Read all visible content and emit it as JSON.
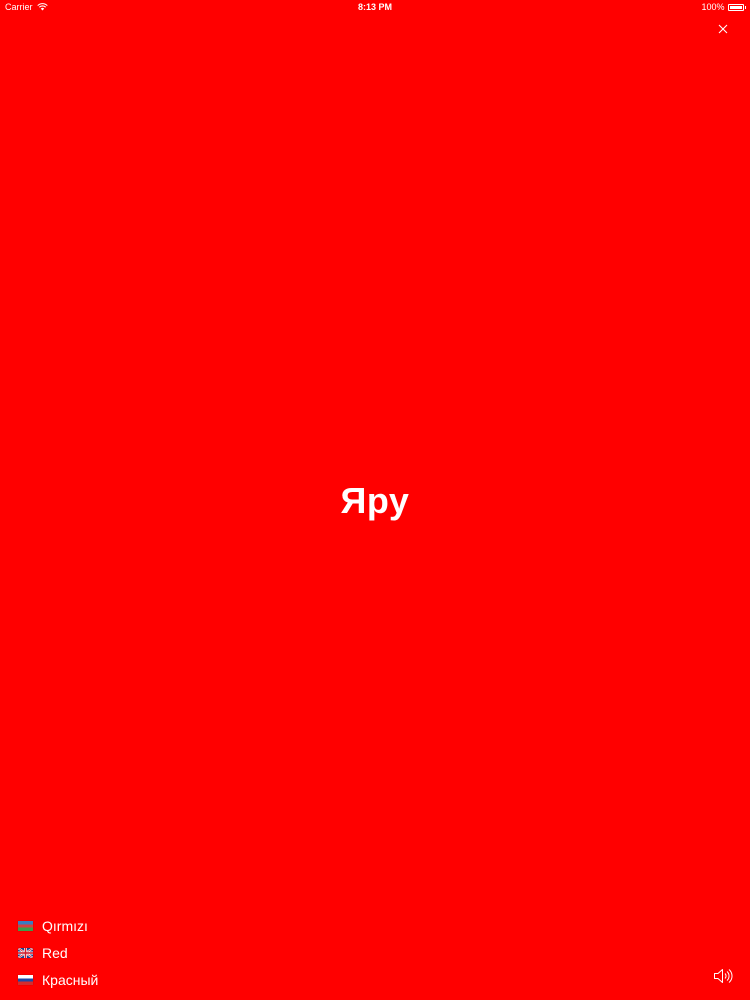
{
  "status_bar": {
    "carrier": "Carrier",
    "time": "8:13 PM",
    "battery": "100%",
    "battery_level": 1.0
  },
  "card": {
    "background_color": "#ff0000",
    "word": "Яру"
  },
  "translations": [
    {
      "flag": "azerbaijan-flag-icon",
      "text": "Qırmızı"
    },
    {
      "flag": "uk-flag-icon",
      "text": "Red"
    },
    {
      "flag": "russia-flag-icon",
      "text": "Красный"
    }
  ],
  "icons": {
    "close": "close-icon",
    "sound": "speaker-icon",
    "wifi": "wifi-icon"
  }
}
